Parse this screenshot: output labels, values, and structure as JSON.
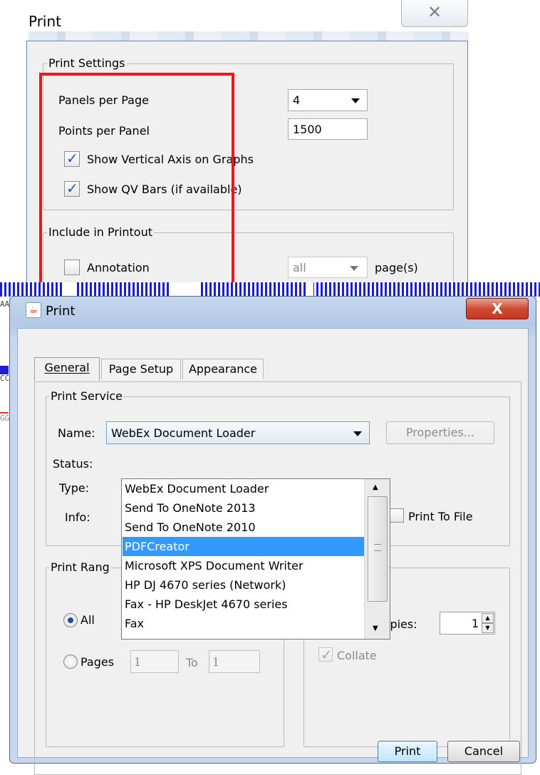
{
  "top_dialog": {
    "title": "Print",
    "close_glyph": "✕",
    "print_settings_legend": "Print Settings",
    "panels_per_page_label": "Panels per Page",
    "panels_per_page_value": "4",
    "points_per_panel_label": "Points per Panel",
    "points_per_panel_value": "1500",
    "show_vertical_axis_label": "Show Vertical Axis on Graphs",
    "show_qv_bars_label": "Show QV Bars (if available)",
    "include_legend": "Include in Printout",
    "annotation_label": "Annotation",
    "annotation_pages_value": "all",
    "pages_suffix": "page(s)"
  },
  "band": {
    "frag1": "AA",
    "frag2": "CC",
    "frag3": "GG"
  },
  "front_dialog": {
    "title": "Print",
    "close_glyph": "X",
    "java_icon_glyph": "☕",
    "tabs": [
      "General",
      "Page Setup",
      "Appearance"
    ],
    "print_service_legend": "Print Service",
    "name_label": "Name:",
    "name_value": "WebEx Document Loader",
    "properties_button": "Properties...",
    "status_label": "Status:",
    "type_label": "Type:",
    "info_label": "Info:",
    "print_to_file_label": "Print To File",
    "printers": [
      "WebEx Document Loader",
      "Send To OneNote 2013",
      "Send To OneNote 2010",
      "PDFCreator",
      "Microsoft XPS Document Writer",
      "HP DJ 4670 series (Network)",
      "Fax - HP DeskJet 4670 series",
      "Fax"
    ],
    "print_range_legend": "Print Rang",
    "all_label": "All",
    "pages_label": "Pages",
    "pages_from": "1",
    "to_label": "To",
    "pages_to": "1",
    "number_of_copies_label": "Number of copies:",
    "copies_value": "1",
    "collate_label": "Collate",
    "print_button": "Print",
    "cancel_button": "Cancel"
  },
  "colors": {
    "highlight_red": "#ff1010",
    "selection_blue": "#3399ff",
    "band_blue": "#1b1fd0"
  }
}
